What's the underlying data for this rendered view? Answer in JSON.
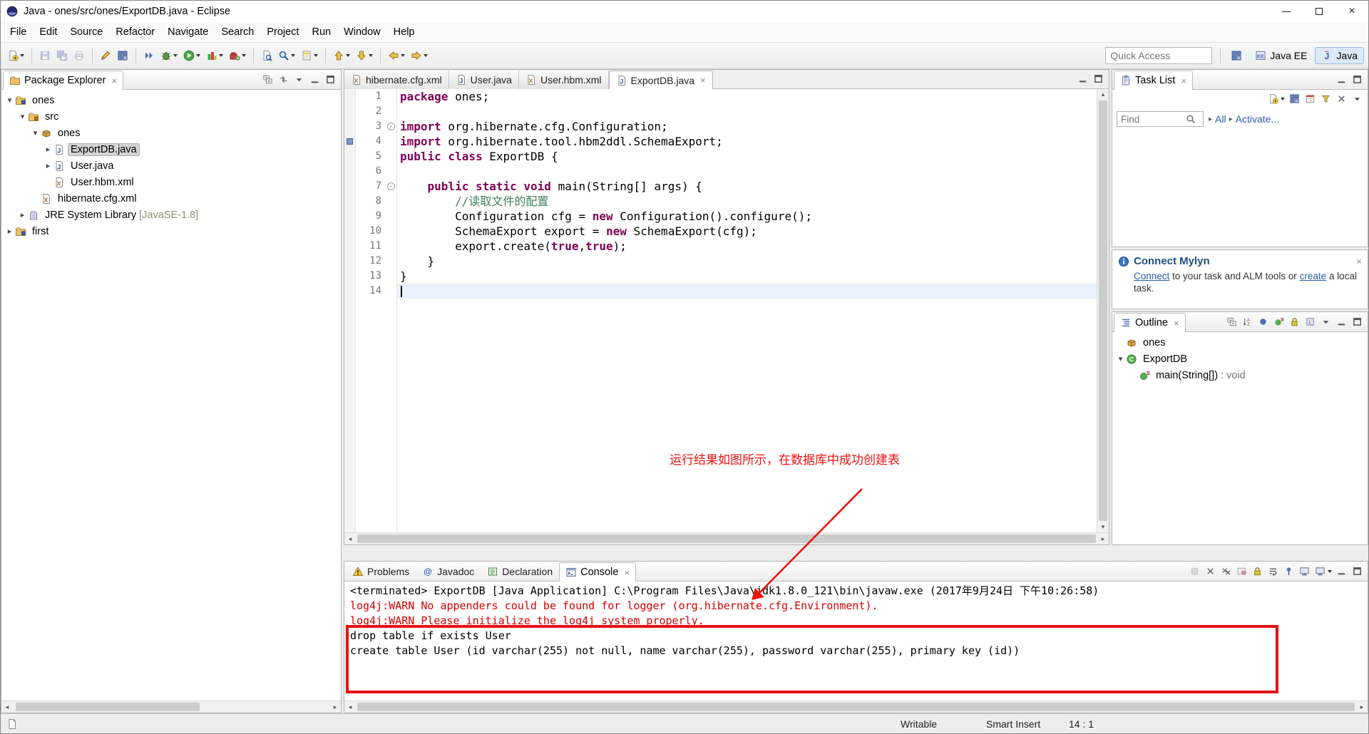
{
  "window": {
    "title": "Java - ones/src/ones/ExportDB.java - Eclipse"
  },
  "menu_bar": {
    "items": [
      "File",
      "Edit",
      "Source",
      "Refactor",
      "Navigate",
      "Search",
      "Project",
      "Run",
      "Window",
      "Help"
    ]
  },
  "toolbar": {
    "quick_access_placeholder": "Quick Access",
    "perspectives": [
      {
        "label": "Java EE",
        "icon": "java-ee-perspective-icon",
        "icon_kind": "javaee",
        "active": false
      },
      {
        "label": "Java",
        "icon": "java-perspective-icon",
        "icon_kind": "javap",
        "active": true
      }
    ],
    "icons": [
      {
        "name": "new-wizard",
        "kind": "doc-new",
        "dropdown": true
      },
      {
        "sep": true
      },
      {
        "name": "save",
        "kind": "floppy",
        "disabled": true
      },
      {
        "name": "save-all",
        "kind": "floppy-all",
        "disabled": true
      },
      {
        "name": "print",
        "kind": "printer",
        "disabled": true
      },
      {
        "sep": true
      },
      {
        "name": "new-java-ee-artifact",
        "kind": "pencil"
      },
      {
        "name": "new-web-service",
        "kind": "grid"
      },
      {
        "sep": true
      },
      {
        "name": "skip-all-breakpoints",
        "kind": "skip"
      },
      {
        "name": "debug",
        "kind": "bug",
        "dropdown": true
      },
      {
        "name": "run",
        "kind": "run",
        "dropdown": true
      },
      {
        "name": "coverage",
        "kind": "coverage",
        "dropdown": true
      },
      {
        "name": "run-external-tools",
        "kind": "gear-run",
        "dropdown": true
      },
      {
        "sep": true
      },
      {
        "name": "open-type",
        "kind": "search-doc"
      },
      {
        "name": "search",
        "kind": "search",
        "dropdown": true
      },
      {
        "name": "toggle-mark-occurrences",
        "kind": "marker",
        "dropdown": true
      },
      {
        "sep": true
      },
      {
        "name": "previous-annotation",
        "kind": "arrow-up",
        "dropdown": true
      },
      {
        "name": "next-annotation",
        "kind": "arrow-down",
        "dropdown": true
      },
      {
        "sep": true
      },
      {
        "name": "back",
        "kind": "arrow-left",
        "dropdown": true
      },
      {
        "name": "forward",
        "kind": "arrow-right",
        "dropdown": true
      }
    ]
  },
  "package_explorer": {
    "title": "Package Explorer",
    "toolbar": [
      {
        "name": "collapse-all",
        "kind": "collapse"
      },
      {
        "name": "link-with-editor",
        "kind": "link"
      },
      {
        "name": "view-menu",
        "kind": "menu"
      },
      {
        "name": "minimize-view",
        "kind": "min"
      },
      {
        "name": "maximize-view",
        "kind": "max"
      }
    ],
    "tree": [
      {
        "label": "ones",
        "depth": 0,
        "icon": "project",
        "expanded": true
      },
      {
        "label": "src",
        "depth": 1,
        "icon": "src-folder",
        "expanded": true
      },
      {
        "label": "ones",
        "depth": 2,
        "icon": "package",
        "expanded": true
      },
      {
        "label": "ExportDB.java",
        "depth": 3,
        "icon": "java-file",
        "collapsed": true,
        "selected": true
      },
      {
        "label": "User.java",
        "depth": 3,
        "icon": "java-file",
        "collapsed": true
      },
      {
        "label": "User.hbm.xml",
        "depth": 3,
        "icon": "xml-file"
      },
      {
        "label": "hibernate.cfg.xml",
        "depth": 2,
        "icon": "xml-file"
      },
      {
        "label": "JRE System Library",
        "suffix": " [JavaSE-1.8]",
        "depth": 1,
        "icon": "library",
        "collapsed": true
      },
      {
        "label": "first",
        "depth": 0,
        "icon": "project",
        "collapsed": true
      }
    ]
  },
  "editor": {
    "controls": [
      {
        "name": "minimize-view",
        "kind": "min"
      },
      {
        "name": "maximize-view",
        "kind": "max"
      }
    ],
    "tabs": [
      {
        "label": "hibernate.cfg.xml",
        "icon": "xml-file-icon",
        "icon_kind": "xml-file",
        "active": false
      },
      {
        "label": "User.java",
        "icon": "java-file-icon",
        "icon_kind": "java-file",
        "active": false
      },
      {
        "label": "User.hbm.xml",
        "icon": "xml-file-icon",
        "icon_kind": "xml-file",
        "active": false
      },
      {
        "label": "ExportDB.java",
        "icon": "java-file-icon",
        "icon_kind": "java-file",
        "active": true,
        "closable": true
      }
    ],
    "lines": [
      {
        "n": 1,
        "seg": [
          [
            "package",
            "kw"
          ],
          [
            " ones;",
            "pl"
          ]
        ]
      },
      {
        "n": 2,
        "seg": []
      },
      {
        "n": 3,
        "fold": true,
        "seg": [
          [
            "import",
            "kw"
          ],
          [
            " org.hibernate.cfg.Configuration;",
            "pl"
          ]
        ]
      },
      {
        "n": 4,
        "marker": true,
        "seg": [
          [
            "import",
            "kw"
          ],
          [
            " org.hibernate.tool.hbm2ddl.SchemaExport;",
            "pl"
          ]
        ]
      },
      {
        "n": 5,
        "seg": [
          [
            "public",
            "kw"
          ],
          [
            " ",
            "pl"
          ],
          [
            "class",
            "kw"
          ],
          [
            " ExportDB {",
            "pl"
          ]
        ]
      },
      {
        "n": 6,
        "seg": []
      },
      {
        "n": 7,
        "fold": true,
        "seg": [
          [
            "    ",
            "pl"
          ],
          [
            "public",
            "kw"
          ],
          [
            " ",
            "pl"
          ],
          [
            "static",
            "kw"
          ],
          [
            " ",
            "pl"
          ],
          [
            "void",
            "kw"
          ],
          [
            " main(String[] args) {",
            "pl"
          ]
        ]
      },
      {
        "n": 8,
        "seg": [
          [
            "        ",
            "pl"
          ],
          [
            "//读取文件的配置",
            "cm"
          ]
        ]
      },
      {
        "n": 9,
        "seg": [
          [
            "        Configuration cfg = ",
            "pl"
          ],
          [
            "new",
            "kw"
          ],
          [
            " Configuration().configure();",
            "pl"
          ]
        ]
      },
      {
        "n": 10,
        "seg": [
          [
            "        SchemaExport export = ",
            "pl"
          ],
          [
            "new",
            "kw"
          ],
          [
            " SchemaExport(cfg);",
            "pl"
          ]
        ]
      },
      {
        "n": 11,
        "seg": [
          [
            "        export.create(",
            "pl"
          ],
          [
            "true",
            "kw"
          ],
          [
            ",",
            "pl"
          ],
          [
            "true",
            "kw"
          ],
          [
            ");",
            "pl"
          ]
        ]
      },
      {
        "n": 12,
        "seg": [
          [
            "    }",
            "pl"
          ]
        ]
      },
      {
        "n": 13,
        "seg": [
          [
            "}",
            "pl"
          ]
        ]
      },
      {
        "n": 14,
        "current": true,
        "cursor": true,
        "seg": []
      }
    ]
  },
  "task_list": {
    "title": "Task List",
    "find_placeholder": "Find",
    "links": [
      "All",
      "Activate..."
    ],
    "header_controls": [
      {
        "name": "minimize-view",
        "kind": "min"
      },
      {
        "name": "maximize-view",
        "kind": "max"
      }
    ],
    "toolbar": [
      {
        "name": "new-task",
        "kind": "doc-new",
        "dropdown": true
      },
      {
        "name": "categorized-presentation",
        "kind": "grid"
      },
      {
        "name": "scheduled-presentation",
        "kind": "cal"
      },
      {
        "name": "filter-completed-tasks",
        "kind": "filter"
      },
      {
        "name": "delete-task",
        "kind": "cross"
      },
      {
        "name": "view-menu",
        "kind": "menu"
      }
    ]
  },
  "mylyn": {
    "title": "Connect Mylyn",
    "body": [
      {
        "text": "Connect",
        "link": true
      },
      {
        "text": " to your task and ALM tools or "
      },
      {
        "text": "create",
        "link": true
      },
      {
        "text": " a local task."
      }
    ]
  },
  "outline": {
    "title": "Outline",
    "toolbar": [
      {
        "name": "expand-all",
        "kind": "collapse"
      },
      {
        "name": "sort",
        "kind": "sort"
      },
      {
        "name": "hide-fields",
        "kind": "field"
      },
      {
        "name": "hide-static-members",
        "kind": "static"
      },
      {
        "name": "hide-non-public-members",
        "kind": "lock"
      },
      {
        "name": "hide-local-types",
        "kind": "local"
      },
      {
        "name": "view-menu",
        "kind": "menu"
      },
      {
        "name": "minimize-view",
        "kind": "min"
      },
      {
        "name": "maximize-view",
        "kind": "max"
      }
    ],
    "tree": [
      {
        "label": "ones",
        "depth": 0,
        "icon": "package"
      },
      {
        "label": "ExportDB",
        "depth": 0,
        "icon": "class",
        "expanded": true
      },
      {
        "label": "main(String[])",
        "suffix": " : void",
        "depth": 1,
        "icon": "method"
      }
    ]
  },
  "bottom_views": {
    "tabs": [
      {
        "label": "Problems",
        "icon": "problems-icon",
        "icon_kind": "problems"
      },
      {
        "label": "Javadoc",
        "icon": "javadoc-icon",
        "icon_kind": "at"
      },
      {
        "label": "Declaration",
        "icon": "declaration-icon",
        "icon_kind": "decl"
      },
      {
        "label": "Console",
        "icon": "console-icon",
        "icon_kind": "console",
        "active": true,
        "closable": true
      }
    ]
  },
  "console": {
    "header": "<terminated> ExportDB [Java Application] C:\\Program Files\\Java\\jdk1.8.0_121\\bin\\javaw.exe (2017年9月24日 下午10:26:58)",
    "lines": [
      {
        "text": "log4j:WARN No appenders could be found for logger (org.hibernate.cfg.Environment).",
        "color": "red"
      },
      {
        "text": "log4j:WARN Please initialize the log4j system properly.",
        "color": "red"
      },
      {
        "text": "drop table if exists User",
        "color": "black"
      },
      {
        "text": "create table User (id varchar(255) not null, name varchar(255), password varchar(255), primary key (id))",
        "color": "black"
      }
    ],
    "toolbar": [
      {
        "name": "terminate",
        "kind": "stop",
        "disabled": true
      },
      {
        "name": "remove-launch",
        "kind": "cross"
      },
      {
        "name": "remove-all-terminated",
        "kind": "dcross"
      },
      {
        "name": "clear-console",
        "kind": "clear"
      },
      {
        "name": "scroll-lock",
        "kind": "lock"
      },
      {
        "name": "word-wrap",
        "kind": "wrap"
      },
      {
        "name": "pin-console",
        "kind": "pin"
      },
      {
        "name": "display-selected-console",
        "kind": "monitor"
      },
      {
        "name": "open-console",
        "kind": "monitor",
        "dropdown": true
      },
      {
        "name": "minimize-view",
        "kind": "min"
      },
      {
        "name": "maximize-view",
        "kind": "max"
      }
    ]
  },
  "annotation": {
    "text": "运行结果如图所示，在数据库中成功创建表",
    "color": "#ee1111"
  },
  "status_bar": {
    "items": [
      "Writable",
      "Smart Insert",
      "14 : 1"
    ]
  }
}
